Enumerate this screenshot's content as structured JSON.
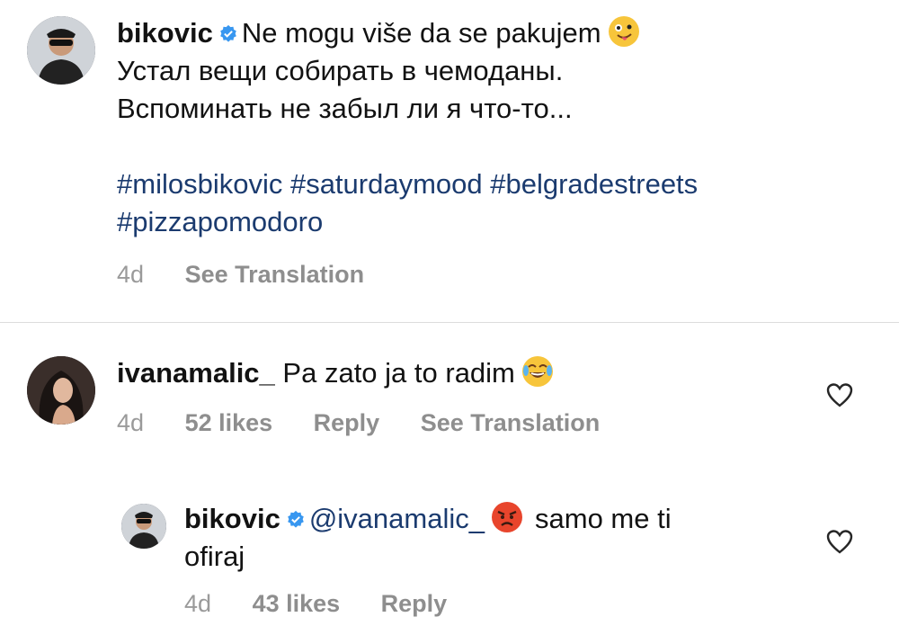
{
  "post": {
    "username": "bikovic",
    "caption_line1": "Ne mogu više da se pakujem",
    "caption_line2": "Устал вещи собирать в чемоданы.",
    "caption_line3": "Вспоминать не забыл ли я что-то...",
    "hashtags_line1": "#milosbikovic #saturdaymood #belgradestreets",
    "hashtags_line2": "#pizzapomodoro",
    "time": "4d",
    "see_translation": "See Translation",
    "emoji": "zany-face-emoji"
  },
  "comments": [
    {
      "username": "ivanamalic_",
      "text": "Pa zato ja to radim",
      "emoji": "tears-of-joy-emoji",
      "time": "4d",
      "likes": "52 likes",
      "reply": "Reply",
      "see_translation": "See Translation"
    },
    {
      "username": "bikovic",
      "mention": "@ivanamalic_",
      "text_part1": "samo me ti",
      "text_part2": "ofiraj",
      "emoji": "angry-face-emoji",
      "time": "4d",
      "likes": "43 likes",
      "reply": "Reply"
    }
  ],
  "colors": {
    "hashtag": "#1b3b6f",
    "meta": "#8e8e8e",
    "verified": "#3897f0"
  }
}
